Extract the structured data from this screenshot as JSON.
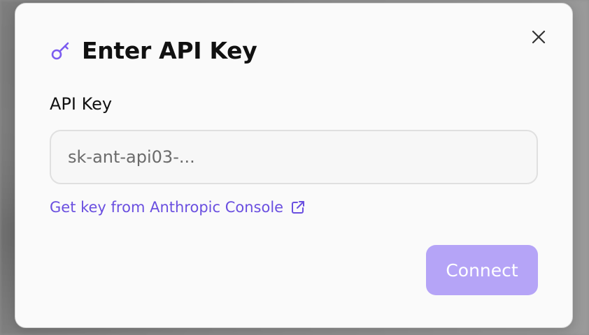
{
  "dialog": {
    "title": "Enter API Key",
    "field_label": "API Key",
    "input": {
      "value": "",
      "placeholder": "sk-ant-api03-..."
    },
    "link_label": "Get key from Anthropic Console",
    "connect_label": "Connect",
    "icons": {
      "title": "key-icon",
      "close": "close-icon",
      "link": "external-link-icon"
    },
    "colors": {
      "accent": "#6a4fe0",
      "connect_disabled_bg": "#b5a4f7",
      "key_icon": "#7c5cf0"
    }
  }
}
